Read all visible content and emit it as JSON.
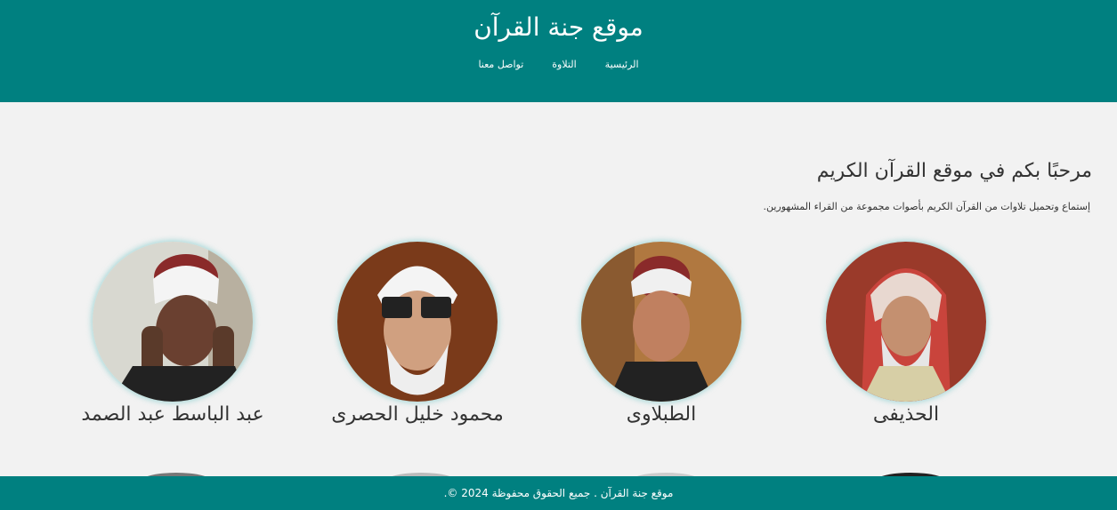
{
  "header": {
    "site_title": "موقع جنة القرآن",
    "nav": [
      {
        "label": "الرئيسية"
      },
      {
        "label": "التلاوة"
      },
      {
        "label": "تواصل معنا"
      }
    ]
  },
  "main": {
    "welcome_title": "مرحبًا بكم في موقع القرآن الكريم",
    "welcome_text": "إستماع وتحميل تلاوات من القرآن الكريم بأصوات مجموعة من القراء المشهورين."
  },
  "reciters": [
    {
      "name": "الحذيفى",
      "icon": "reciter-photo"
    },
    {
      "name": "الطبلاوى",
      "icon": "reciter-photo"
    },
    {
      "name": "محمود خليل الحصرى",
      "icon": "reciter-photo"
    },
    {
      "name": "عبد الباسط عبد الصمد",
      "icon": "reciter-photo"
    }
  ],
  "footer": {
    "text": "موقع جنة القرآن . جميع الحقوق محفوظة 2024 ©."
  },
  "colors": {
    "primary": "#008080",
    "background": "#f2f2f2",
    "text": "#333333"
  }
}
